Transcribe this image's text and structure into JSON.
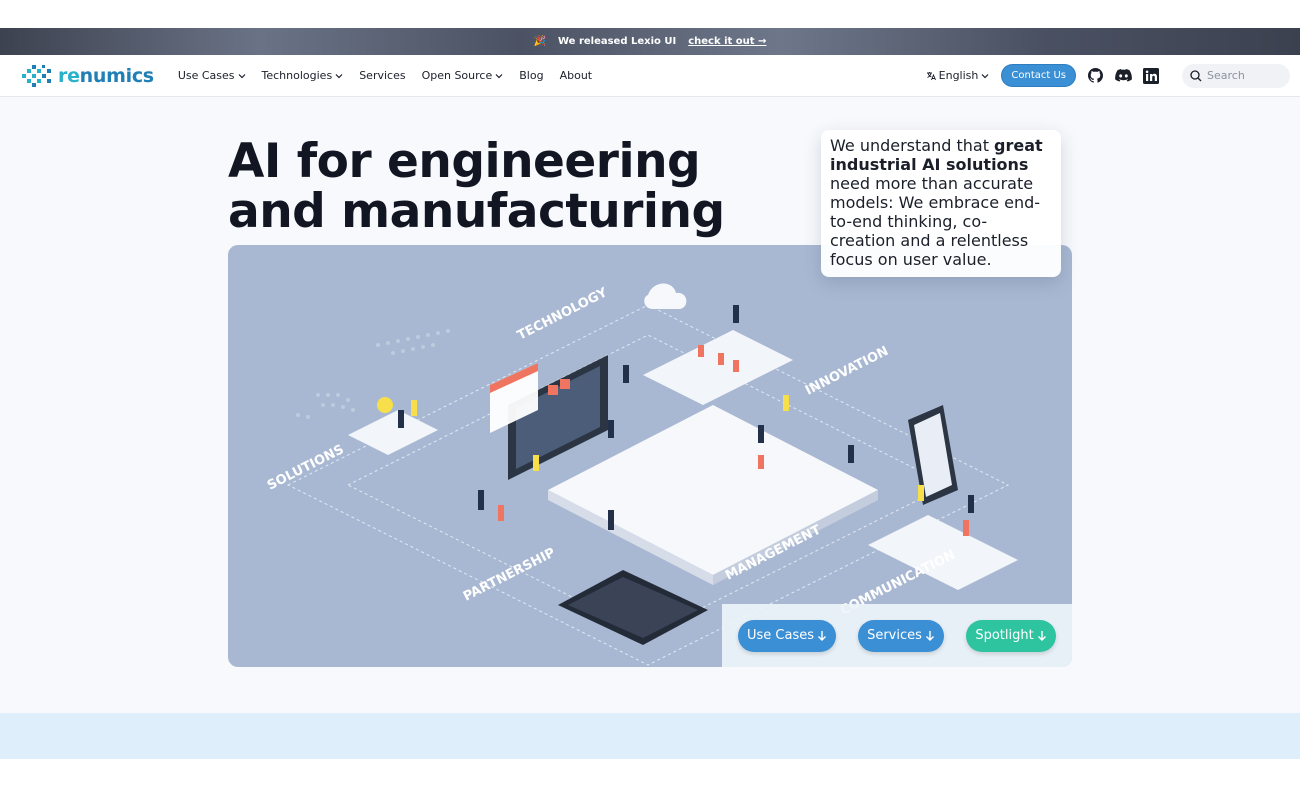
{
  "announcement": {
    "emoji": "🎉",
    "text": "We released Lexio UI",
    "link": "check it out →"
  },
  "nav": {
    "logo_text_a": "re",
    "logo_text_b": "numics",
    "items": [
      {
        "label": "Use Cases",
        "dropdown": true
      },
      {
        "label": "Technologies",
        "dropdown": true
      },
      {
        "label": "Services",
        "dropdown": false
      },
      {
        "label": "Open Source",
        "dropdown": true
      },
      {
        "label": "Blog",
        "dropdown": false
      },
      {
        "label": "About",
        "dropdown": false
      }
    ],
    "language": "English",
    "contact_label": "Contact Us",
    "search_placeholder": "Search",
    "icons": [
      "github-icon",
      "discord-icon",
      "linkedin-icon"
    ]
  },
  "hero": {
    "title_line1": "AI for engineering",
    "title_line2": "and manufacturing",
    "callout_pre": "We understand that ",
    "callout_bold": "great industrial AI solutions",
    "callout_post": " need more than accurate models: We embrace end-to-end thinking, co-creation and a relentless focus on user value.",
    "illustration_labels": [
      "TECHNOLOGY",
      "INNOVATION",
      "SOLUTIONS",
      "PARTNERSHIP",
      "MANAGEMENT",
      "COMMUNICATION"
    ],
    "buttons": [
      {
        "label": "Use Cases",
        "style": "blue"
      },
      {
        "label": "Services",
        "style": "blue"
      },
      {
        "label": "Spotlight",
        "style": "teal"
      }
    ]
  },
  "colors": {
    "brand_blue": "#3b8fd4",
    "teal": "#2fc4a0",
    "illustration_bg": "#a9b8d2"
  }
}
